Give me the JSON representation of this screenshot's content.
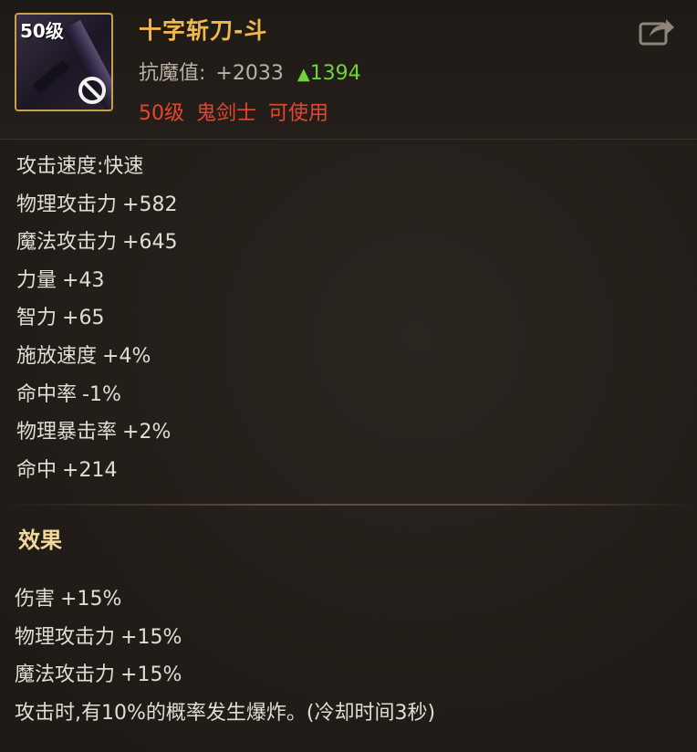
{
  "item": {
    "level_badge": "50级",
    "name": "十字斩刀-斗",
    "resist_label": "抗魔值:",
    "resist_value": "+2033",
    "resist_delta_arrow": "▲",
    "resist_delta": "1394",
    "requirement_level": "50级",
    "requirement_class": "鬼剑士",
    "requirement_status": "可使用",
    "icons": {
      "weapon": "katana-icon",
      "unusable": "ban-icon",
      "share": "share-icon"
    }
  },
  "stats": [
    {
      "label": "攻击速度:",
      "value": "快速"
    },
    {
      "label": "物理攻击力",
      "value": "+582"
    },
    {
      "label": "魔法攻击力",
      "value": "+645"
    },
    {
      "label": "力量",
      "value": "+43"
    },
    {
      "label": "智力",
      "value": "+65"
    },
    {
      "label": "施放速度",
      "value": "+4%"
    },
    {
      "label": "命中率",
      "value": "-1%"
    },
    {
      "label": "物理暴击率",
      "value": "+2%"
    },
    {
      "label": "命中",
      "value": "+214"
    }
  ],
  "effect_section": {
    "title": "效果",
    "lines": [
      {
        "label": "伤害",
        "value": "+15%"
      },
      {
        "label": "物理攻击力",
        "value": "+15%"
      },
      {
        "label": "魔法攻击力",
        "value": "+15%"
      },
      {
        "label": "攻击时,有10%的概率发生爆炸。(冷却时间3秒)",
        "value": ""
      }
    ]
  },
  "colors": {
    "name": "#f0b84b",
    "delta_up": "#73d23c",
    "requirement": "#e8452f",
    "effect_title": "#f4d79a"
  }
}
